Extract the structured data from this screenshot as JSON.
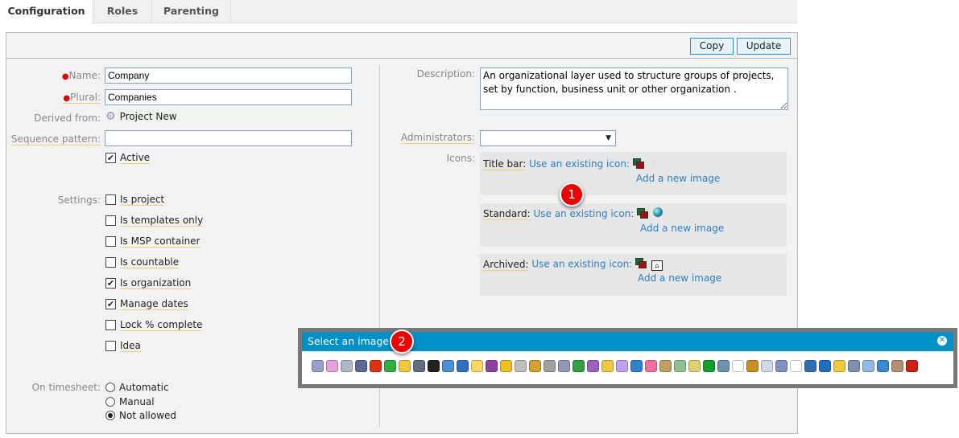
{
  "tabs": [
    "Configuration",
    "Roles",
    "Parenting"
  ],
  "toolbar": {
    "copy": "Copy",
    "update": "Update"
  },
  "form": {
    "name_label": "Name:",
    "name_value": "Company",
    "plural_label": "Plural:",
    "plural_value": "Companies",
    "derived_label": "Derived from:",
    "derived_value": "Project New",
    "sequence_label": "Sequence pattern:",
    "sequence_value": "",
    "active_label": "Active",
    "active_checked": true,
    "settings_label": "Settings:",
    "settings": [
      {
        "label": "Is project",
        "checked": false
      },
      {
        "label": "Is templates only",
        "checked": false
      },
      {
        "label": "Is MSP container",
        "checked": false
      },
      {
        "label": "Is countable",
        "checked": false
      },
      {
        "label": "Is organization",
        "checked": true
      },
      {
        "label": "Manage dates",
        "checked": true
      },
      {
        "label": "Lock % complete",
        "checked": false
      },
      {
        "label": "Idea",
        "checked": false
      }
    ],
    "timesheet_label": "On timesheet:",
    "timesheet_options": [
      {
        "label": "Automatic",
        "selected": false
      },
      {
        "label": "Manual",
        "selected": false
      },
      {
        "label": "Not allowed",
        "selected": true
      }
    ],
    "description_label": "Description:",
    "description_value": "An organizational layer used to structure groups of projects, set by function, business unit or other organization .",
    "administrators_label": "Administrators:",
    "administrators_value": "",
    "icons_label": "Icons:",
    "icon_rows": [
      {
        "label": "Title bar:",
        "link": "Use an existing icon:",
        "add": "Add a new image",
        "current": "sun-icon"
      },
      {
        "label": "Standard:",
        "link": "Use an existing icon:",
        "add": "Add a new image",
        "current": "globe-icon"
      },
      {
        "label": "Archived:",
        "link": "Use an existing icon:",
        "add": "Add a new image",
        "current": "archive-icon"
      }
    ]
  },
  "callouts": [
    "1",
    "2"
  ],
  "popup": {
    "title": "Select an image",
    "icons": [
      {
        "name": "gear",
        "color": "#9aa0c8"
      },
      {
        "name": "lightbulb-pink",
        "color": "#e6a0e0"
      },
      {
        "name": "server-warning",
        "color": "#b0b8c8"
      },
      {
        "name": "computer",
        "color": "#5a6a90"
      },
      {
        "name": "target",
        "color": "#e03010"
      },
      {
        "name": "recycle",
        "color": "#30b040"
      },
      {
        "name": "folder",
        "color": "#f0c840"
      },
      {
        "name": "list",
        "color": "#607080"
      },
      {
        "name": "diamond",
        "color": "#222222"
      },
      {
        "name": "window",
        "color": "#4a90d8"
      },
      {
        "name": "building",
        "color": "#3070c0"
      },
      {
        "name": "lightbulb",
        "color": "#f8d860"
      },
      {
        "name": "columns-purple",
        "color": "#9040a0"
      },
      {
        "name": "footprints",
        "color": "#f0c020"
      },
      {
        "name": "checklist",
        "color": "#c0c0c0"
      },
      {
        "name": "box",
        "color": "#d0a030"
      },
      {
        "name": "funnel",
        "color": "#a0a0a0"
      },
      {
        "name": "gears",
        "color": "#9098b8"
      },
      {
        "name": "gear-check",
        "color": "#30a040"
      },
      {
        "name": "book-purple",
        "color": "#a060c0"
      },
      {
        "name": "folder-add",
        "color": "#f0c840"
      },
      {
        "name": "footprints-purple",
        "color": "#c0a0f0"
      },
      {
        "name": "book-blue",
        "color": "#3080d0"
      },
      {
        "name": "pink-shape",
        "color": "#f070a0"
      },
      {
        "name": "hammer",
        "color": "#c0a060"
      },
      {
        "name": "chat-edit",
        "color": "#90c090"
      },
      {
        "name": "columns-yellow",
        "color": "#e0d070"
      },
      {
        "name": "green-diamond",
        "color": "#10a030"
      },
      {
        "name": "bar-chart",
        "color": "#7090b0"
      },
      {
        "name": "page-arrow",
        "color": "#ffffff"
      },
      {
        "name": "money-bag",
        "color": "#c89020"
      },
      {
        "name": "document-gear",
        "color": "#d0d8e8"
      },
      {
        "name": "phone",
        "color": "#8090c0"
      },
      {
        "name": "blank-page",
        "color": "#ffffff"
      },
      {
        "name": "umbrella",
        "color": "#3070b0"
      },
      {
        "name": "checkbox",
        "color": "#2070c0"
      },
      {
        "name": "folder-gear",
        "color": "#f0c840"
      },
      {
        "name": "database",
        "color": "#8090b0"
      },
      {
        "name": "clock",
        "color": "#90b8e0"
      },
      {
        "name": "globe",
        "color": "#3a8ad0"
      },
      {
        "name": "columns-brown",
        "color": "#b09070"
      },
      {
        "name": "bug",
        "color": "#d02010"
      }
    ]
  }
}
